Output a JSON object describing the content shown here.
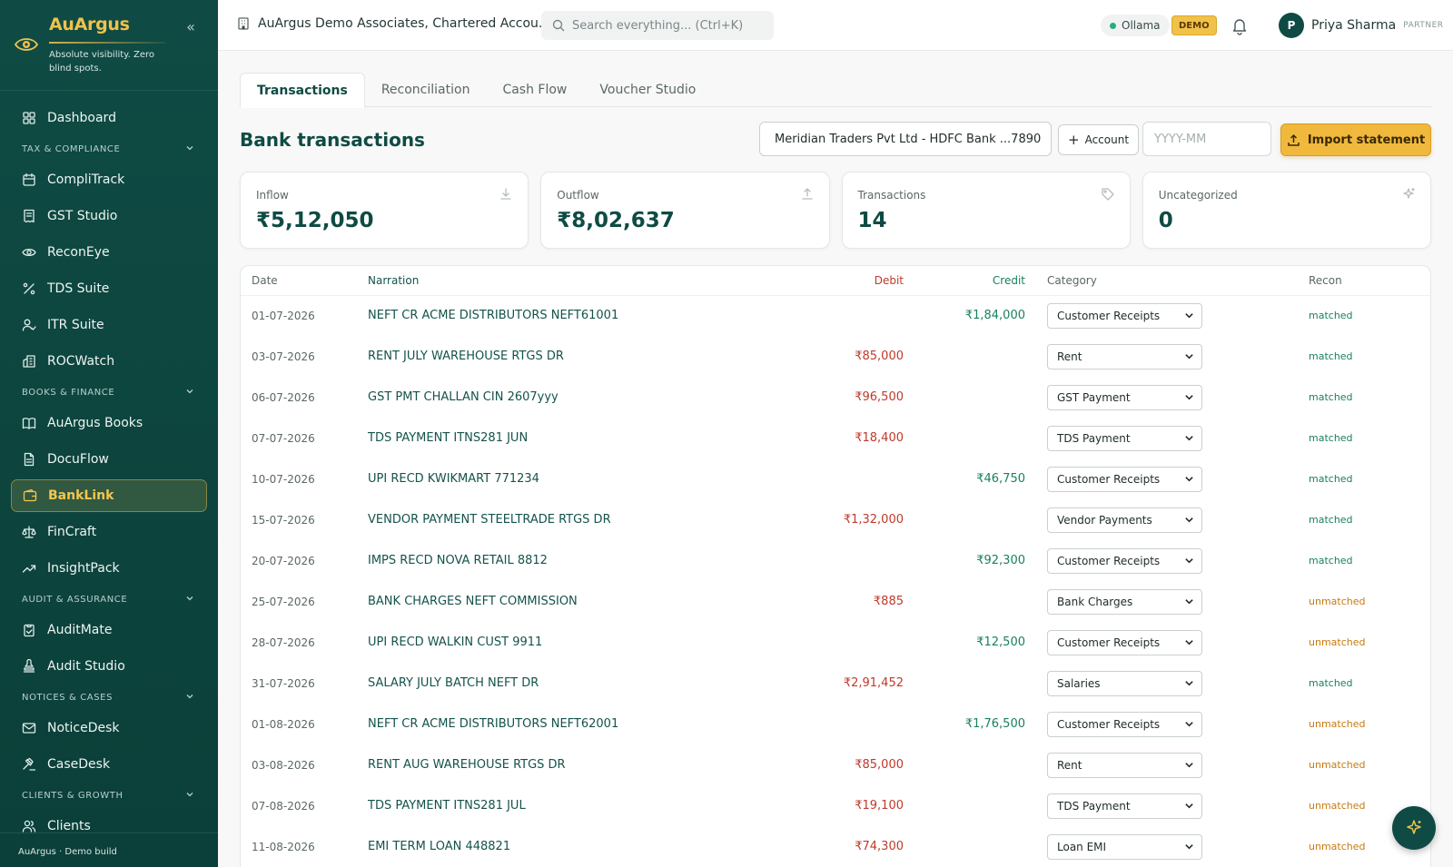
{
  "brand": {
    "name": "AuArgus",
    "tagline": "Absolute visibility. Zero blind spots."
  },
  "sidebar": {
    "items": [
      {
        "type": "item",
        "label": "Dashboard",
        "icon": "grid-icon"
      },
      {
        "type": "section",
        "label": "TAX & COMPLIANCE"
      },
      {
        "type": "item",
        "label": "CompliTrack",
        "icon": "calendar-icon"
      },
      {
        "type": "item",
        "label": "GST Studio",
        "icon": "receipt-icon"
      },
      {
        "type": "item",
        "label": "ReconEye",
        "icon": "eye-icon"
      },
      {
        "type": "item",
        "label": "TDS Suite",
        "icon": "percent-icon"
      },
      {
        "type": "item",
        "label": "ITR Suite",
        "icon": "user-check-icon"
      },
      {
        "type": "item",
        "label": "ROCWatch",
        "icon": "building-icon"
      },
      {
        "type": "section",
        "label": "BOOKS & FINANCE"
      },
      {
        "type": "item",
        "label": "AuArgus Books",
        "icon": "book-icon"
      },
      {
        "type": "item",
        "label": "DocuFlow",
        "icon": "document-icon"
      },
      {
        "type": "item",
        "label": "BankLink",
        "icon": "wallet-icon",
        "active": true
      },
      {
        "type": "item",
        "label": "FinCraft",
        "icon": "scale-icon"
      },
      {
        "type": "item",
        "label": "InsightPack",
        "icon": "trend-icon"
      },
      {
        "type": "section",
        "label": "AUDIT & ASSURANCE"
      },
      {
        "type": "item",
        "label": "AuditMate",
        "icon": "clipboard-check-icon"
      },
      {
        "type": "item",
        "label": "Audit Studio",
        "icon": "stamp-icon"
      },
      {
        "type": "section",
        "label": "NOTICES & CASES"
      },
      {
        "type": "item",
        "label": "NoticeDesk",
        "icon": "mail-icon"
      },
      {
        "type": "item",
        "label": "CaseDesk",
        "icon": "gavel-icon"
      },
      {
        "type": "section",
        "label": "CLIENTS & GROWTH"
      },
      {
        "type": "item",
        "label": "Clients",
        "icon": "users-icon"
      }
    ],
    "footer": "AuArgus · Demo build"
  },
  "topbar": {
    "org": "AuArgus Demo Associates, Chartered Accou...",
    "search_placeholder": "Search everything... (Ctrl+K)",
    "status": "Ollama",
    "demo_badge": "DEMO",
    "user_initial": "P",
    "user_name": "Priya Sharma",
    "user_role": "PARTNER"
  },
  "tabs": [
    "Transactions",
    "Reconciliation",
    "Cash Flow",
    "Voucher Studio"
  ],
  "page": {
    "title": "Bank transactions",
    "account": "Meridian Traders Pvt Ltd - HDFC Bank ...7890",
    "add_account": "Account",
    "month_placeholder": "YYYY-MM",
    "import_label": "Import statement"
  },
  "stats": [
    {
      "label": "Inflow",
      "value": "₹5,12,050",
      "icon": "download-icon"
    },
    {
      "label": "Outflow",
      "value": "₹8,02,637",
      "icon": "upload-icon"
    },
    {
      "label": "Transactions",
      "value": "14",
      "icon": "tag-icon"
    },
    {
      "label": "Uncategorized",
      "value": "0",
      "icon": "sparkle-icon"
    }
  ],
  "table": {
    "headers": {
      "date": "Date",
      "narration": "Narration",
      "debit": "Debit",
      "credit": "Credit",
      "category": "Category",
      "recon": "Recon"
    },
    "rows": [
      {
        "date": "01-07-2026",
        "narration": "NEFT CR ACME DISTRIBUTORS NEFT61001",
        "debit": "",
        "credit": "₹1,84,000",
        "category": "Customer Receipts",
        "recon": "matched"
      },
      {
        "date": "03-07-2026",
        "narration": "RENT JULY WAREHOUSE RTGS DR",
        "debit": "₹85,000",
        "credit": "",
        "category": "Rent",
        "recon": "matched"
      },
      {
        "date": "06-07-2026",
        "narration": "GST PMT CHALLAN CIN 2607yyy",
        "debit": "₹96,500",
        "credit": "",
        "category": "GST Payment",
        "recon": "matched"
      },
      {
        "date": "07-07-2026",
        "narration": "TDS PAYMENT ITNS281 JUN",
        "debit": "₹18,400",
        "credit": "",
        "category": "TDS Payment",
        "recon": "matched"
      },
      {
        "date": "10-07-2026",
        "narration": "UPI RECD KWIKMART 771234",
        "debit": "",
        "credit": "₹46,750",
        "category": "Customer Receipts",
        "recon": "matched"
      },
      {
        "date": "15-07-2026",
        "narration": "VENDOR PAYMENT STEELTRADE RTGS DR",
        "debit": "₹1,32,000",
        "credit": "",
        "category": "Vendor Payments",
        "recon": "matched"
      },
      {
        "date": "20-07-2026",
        "narration": "IMPS RECD NOVA RETAIL 8812",
        "debit": "",
        "credit": "₹92,300",
        "category": "Customer Receipts",
        "recon": "matched"
      },
      {
        "date": "25-07-2026",
        "narration": "BANK CHARGES NEFT COMMISSION",
        "debit": "₹885",
        "credit": "",
        "category": "Bank Charges",
        "recon": "unmatched"
      },
      {
        "date": "28-07-2026",
        "narration": "UPI RECD WALKIN CUST 9911",
        "debit": "",
        "credit": "₹12,500",
        "category": "Customer Receipts",
        "recon": "unmatched"
      },
      {
        "date": "31-07-2026",
        "narration": "SALARY JULY BATCH NEFT DR",
        "debit": "₹2,91,452",
        "credit": "",
        "category": "Salaries",
        "recon": "matched"
      },
      {
        "date": "01-08-2026",
        "narration": "NEFT CR ACME DISTRIBUTORS NEFT62001",
        "debit": "",
        "credit": "₹1,76,500",
        "category": "Customer Receipts",
        "recon": "unmatched"
      },
      {
        "date": "03-08-2026",
        "narration": "RENT AUG WAREHOUSE RTGS DR",
        "debit": "₹85,000",
        "credit": "",
        "category": "Rent",
        "recon": "unmatched"
      },
      {
        "date": "07-08-2026",
        "narration": "TDS PAYMENT ITNS281 JUL",
        "debit": "₹19,100",
        "credit": "",
        "category": "TDS Payment",
        "recon": "unmatched"
      },
      {
        "date": "11-08-2026",
        "narration": "EMI TERM LOAN 448821",
        "debit": "₹74,300",
        "credit": "",
        "category": "Loan EMI",
        "recon": "unmatched"
      }
    ]
  }
}
